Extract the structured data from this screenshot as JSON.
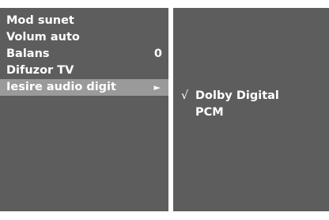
{
  "menu": {
    "items": [
      {
        "label": "Mod sunet",
        "value": ""
      },
      {
        "label": "Volum auto",
        "value": ""
      },
      {
        "label": "Balans",
        "value": "0"
      },
      {
        "label": "Difuzor TV",
        "value": ""
      },
      {
        "label": "Iesire audio digit",
        "arrow": "►"
      }
    ],
    "selected_index": 4
  },
  "submenu": {
    "options": [
      {
        "label": "Dolby Digital",
        "check": "√"
      },
      {
        "label": "PCM",
        "check": ""
      }
    ]
  },
  "colors": {
    "panel": "#5d5d5d",
    "highlight": "#9a9a9a",
    "text": "#ffffff",
    "divider": "#ffffff"
  },
  "icons": {
    "submenu_arrow": "triangle-right-icon",
    "selected_check": "checkmark-icon"
  }
}
